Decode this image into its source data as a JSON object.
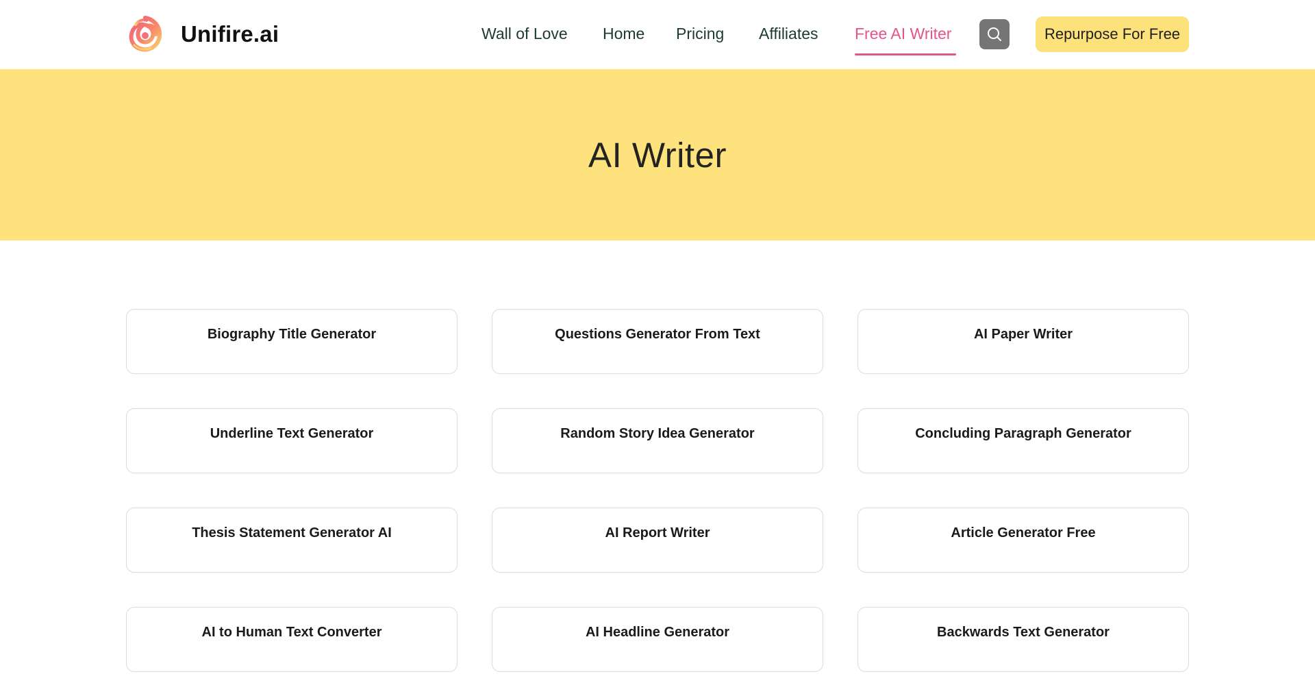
{
  "brand": {
    "name": "Unifire.ai",
    "logo_icon": "flame-swirl-logo-icon"
  },
  "colors": {
    "hero_background": "#fee27d",
    "cta_background": "#fde17b",
    "accent": "#e5538d",
    "nav_text": "#1d3a2e",
    "search_button": "#757575"
  },
  "nav": {
    "items": [
      {
        "label": "Wall of Love",
        "active": false
      },
      {
        "label": "Home",
        "active": false
      },
      {
        "label": "Pricing",
        "active": false
      },
      {
        "label": "Affiliates",
        "active": false
      },
      {
        "label": "Free AI Writer",
        "active": true
      }
    ],
    "search_icon": "search-icon",
    "cta_label": "Repurpose For Free"
  },
  "hero": {
    "title": "AI Writer"
  },
  "tools": [
    {
      "label": "Biography Title Generator"
    },
    {
      "label": "Questions Generator From Text"
    },
    {
      "label": "AI Paper Writer"
    },
    {
      "label": "Underline Text Generator"
    },
    {
      "label": "Random Story Idea Generator"
    },
    {
      "label": "Concluding Paragraph Generator"
    },
    {
      "label": "Thesis Statement Generator AI"
    },
    {
      "label": "AI Report Writer"
    },
    {
      "label": "Article Generator Free"
    },
    {
      "label": "AI to Human Text Converter"
    },
    {
      "label": "AI Headline Generator"
    },
    {
      "label": "Backwards Text Generator"
    }
  ]
}
